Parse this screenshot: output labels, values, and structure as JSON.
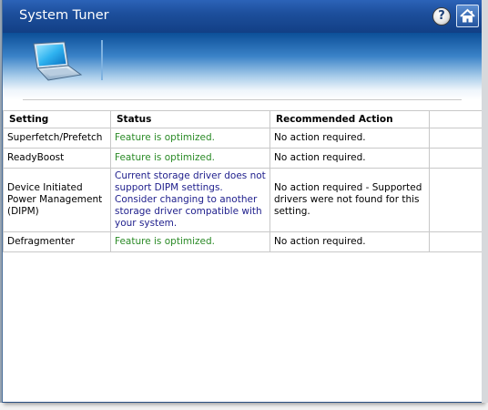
{
  "window": {
    "title": "System Tuner",
    "help_label": "?"
  },
  "table": {
    "headers": [
      "Setting",
      "Status",
      "Recommended Action",
      ""
    ],
    "rows": [
      {
        "setting": "Superfetch/Prefetch",
        "status": "Feature is optimized.",
        "status_kind": "ok",
        "action": "No action required."
      },
      {
        "setting": "ReadyBoost",
        "status": "Feature is optimized.",
        "status_kind": "ok",
        "action": "No action required."
      },
      {
        "setting": "Device Initiated Power Management (DIPM)",
        "status": "Current storage driver does not support DIPM settings. Consider changing to another storage driver compatible with your system.",
        "status_kind": "warn",
        "action": "No action required - Supported drivers were not found for this setting."
      },
      {
        "setting": "Defragmenter",
        "status": "Feature is optimized.",
        "status_kind": "ok",
        "action": "No action required."
      }
    ]
  },
  "colors": {
    "titlebar": "#1d4f9c",
    "status_ok": "#2a8a26",
    "status_warn": "#1e1e8c"
  },
  "icons": {
    "banner": "laptop-icon",
    "help": "help-icon",
    "home": "home-icon"
  }
}
